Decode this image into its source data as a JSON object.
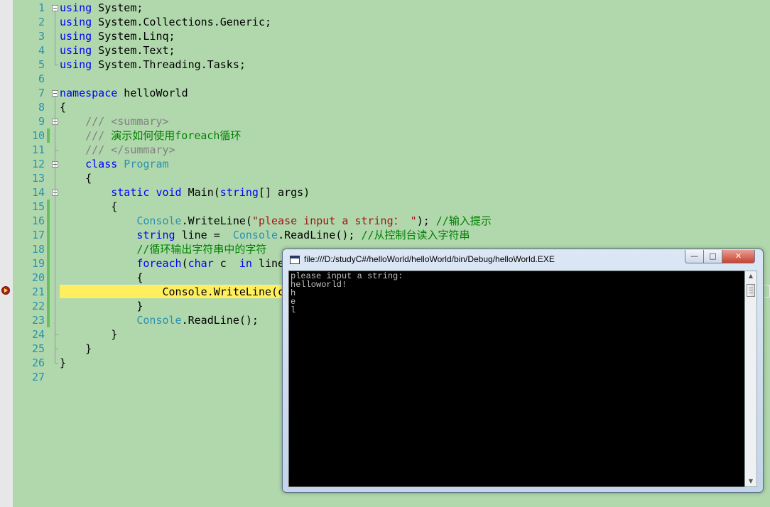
{
  "editor": {
    "line_numbers": [
      "1",
      "2",
      "3",
      "4",
      "5",
      "6",
      "7",
      "8",
      "9",
      "10",
      "11",
      "12",
      "13",
      "14",
      "15",
      "16",
      "17",
      "18",
      "19",
      "20",
      "21",
      "22",
      "23",
      "24",
      "25",
      "26",
      "27"
    ],
    "lines": [
      [
        [
          "kw",
          "using"
        ],
        [
          "",
          "System;"
        ]
      ],
      [
        [
          "kw",
          "using"
        ],
        [
          "",
          "System.Collections.Generic;"
        ]
      ],
      [
        [
          "kw",
          "using"
        ],
        [
          "",
          "System.Linq;"
        ]
      ],
      [
        [
          "kw",
          "using"
        ],
        [
          "",
          "System.Text;"
        ]
      ],
      [
        [
          "kw",
          "using"
        ],
        [
          "",
          "System.Threading.Tasks;"
        ]
      ],
      [],
      [
        [
          "kw",
          "namespace"
        ],
        [
          "",
          "helloWorld"
        ]
      ],
      [
        [
          "",
          "{"
        ]
      ],
      [
        [
          "dc",
          "    ///"
        ],
        [
          "dc",
          "<summary>"
        ]
      ],
      [
        [
          "dc",
          "    ///"
        ],
        [
          "cm",
          "演示如何使用foreach循环"
        ]
      ],
      [
        [
          "dc",
          "    ///"
        ],
        [
          "dc",
          "</summary>"
        ]
      ],
      [
        [
          "kw",
          "    class"
        ],
        [
          "ty",
          "Program"
        ]
      ],
      [
        [
          "",
          "    {"
        ]
      ],
      [
        [
          "kw",
          "        static void"
        ],
        [
          "",
          "Main("
        ],
        [
          "kw",
          "string"
        ],
        [
          "",
          "[] args)"
        ]
      ],
      [
        [
          "",
          "        {"
        ]
      ],
      [
        [
          "ty",
          "            Console"
        ],
        [
          "",
          ".WriteLine("
        ],
        [
          "st",
          "\"please input a string： \""
        ],
        [
          "",
          ");"
        ],
        [
          "cm",
          "//输入提示"
        ]
      ],
      [
        [
          "kw",
          "            string"
        ],
        [
          "",
          "line = "
        ],
        [
          "ty",
          "Console"
        ],
        [
          "",
          ".ReadLine();"
        ],
        [
          "cm",
          "//从控制台读入字符串"
        ]
      ],
      [
        [
          "cm",
          "            //循环输出字符串中的字符"
        ]
      ],
      [
        [
          "kw",
          "            foreach"
        ],
        [
          "",
          "("
        ],
        [
          "kw",
          "char"
        ],
        [
          "",
          "c "
        ],
        [
          "kw",
          "in"
        ],
        [
          "",
          "line)"
        ]
      ],
      [
        [
          "",
          "            {"
        ]
      ],
      [
        [
          "hl",
          "                Console.WriteLine(c);"
        ]
      ],
      [
        [
          "",
          "            }"
        ]
      ],
      [
        [
          "ty",
          "            Console"
        ],
        [
          "",
          ".ReadLine();"
        ]
      ],
      [
        [
          "",
          "        }"
        ]
      ],
      [
        [
          "",
          "    }"
        ]
      ],
      [
        [
          "",
          "}"
        ]
      ],
      []
    ]
  },
  "console_window": {
    "title": "file:///D:/studyC#/helloWorld/helloWorld/bin/Debug/helloWorld.EXE",
    "minimize": "—",
    "maximize": "□",
    "close": "✕",
    "output": [
      "please input a string:",
      "helloworld!",
      "h",
      "e",
      "l"
    ],
    "scroll_up": "▲",
    "scroll_down": "▼"
  },
  "icons": {
    "breakpoint": "current-statement-arrow-icon",
    "console": "console-window-icon"
  }
}
